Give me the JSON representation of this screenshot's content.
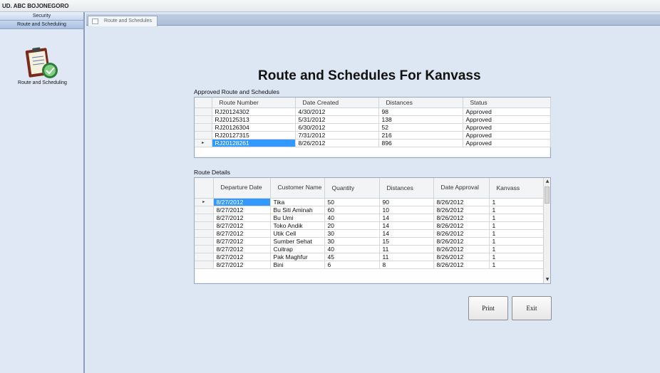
{
  "app": {
    "title": "UD. ABC BOJONEGORO"
  },
  "sidebar": {
    "items": [
      {
        "label": "Security"
      },
      {
        "label": "Route and Scheduling"
      }
    ],
    "icon_label": "Route and Scheduling"
  },
  "tabs": [
    {
      "label": "Route and Schedules"
    }
  ],
  "main": {
    "title": "Route and Schedules For Kanvass",
    "approved": {
      "label": "Approved Route and Schedules",
      "columns": [
        "Route Number",
        "Date Created",
        "Distances",
        "Status"
      ],
      "rows": [
        [
          "RJ20124302",
          "4/30/2012",
          "98",
          "Approved"
        ],
        [
          "RJ20125313",
          "5/31/2012",
          "138",
          "Approved"
        ],
        [
          "RJ20126304",
          "6/30/2012",
          "52",
          "Approved"
        ],
        [
          "RJ20127315",
          "7/31/2012",
          "216",
          "Approved"
        ],
        [
          "RJ20128261",
          "8/26/2012",
          "896",
          "Approved"
        ]
      ],
      "current_row_marker": "▸"
    },
    "details": {
      "label": "Route Details",
      "columns": [
        "Departure Date",
        "Customer Name",
        "Quantity",
        "Distances",
        "Date Approval",
        "Kanvass"
      ],
      "rows": [
        [
          "8/27/2012",
          "Tika",
          "50",
          "90",
          "8/26/2012",
          "1"
        ],
        [
          "8/27/2012",
          "Bu Siti Aminah",
          "60",
          "10",
          "8/26/2012",
          "1"
        ],
        [
          "8/27/2012",
          "Bu Umi",
          "40",
          "14",
          "8/26/2012",
          "1"
        ],
        [
          "8/27/2012",
          "Toko Andik",
          "20",
          "14",
          "8/26/2012",
          "1"
        ],
        [
          "8/27/2012",
          "Utik Cell",
          "30",
          "14",
          "8/26/2012",
          "1"
        ],
        [
          "8/27/2012",
          "Sumber Sehat",
          "30",
          "15",
          "8/26/2012",
          "1"
        ],
        [
          "8/27/2012",
          "Cuitrap",
          "40",
          "11",
          "8/26/2012",
          "1"
        ],
        [
          "8/27/2012",
          "Pak Maghfur",
          "45",
          "11",
          "8/26/2012",
          "1"
        ],
        [
          "8/27/2012",
          "Bini",
          "6",
          "8",
          "8/26/2012",
          "1"
        ]
      ],
      "current_row_marker": "▸"
    },
    "buttons": {
      "print": "Print",
      "exit": "Exit"
    }
  }
}
